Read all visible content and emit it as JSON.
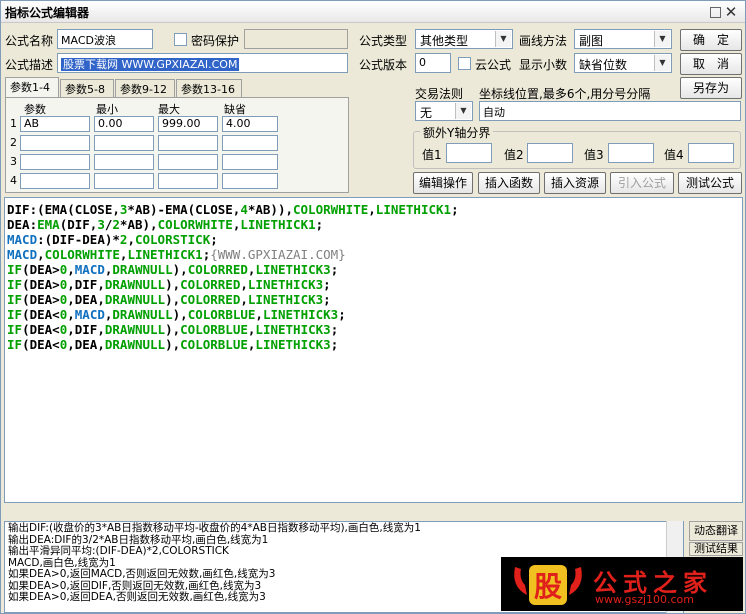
{
  "window": {
    "title": "指标公式编辑器"
  },
  "form": {
    "name_label": "公式名称",
    "name_value": "MACD波浪",
    "password_label": "密码保护",
    "desc_label": "公式描述",
    "desc_value": "股票下载网 WWW.GPXIAZAI.COM",
    "type_label": "公式类型",
    "type_value": "其他类型",
    "draw_label": "画线方法",
    "draw_value": "副图",
    "version_label": "公式版本",
    "version_value": "0",
    "cloud_label": "云公式",
    "decimal_label": "显示小数",
    "decimal_value": "缺省位数",
    "trade_label": "交易法则",
    "trade_value": "无",
    "coord_label": "坐标线位置,最多6个,用分号分隔",
    "coord_value": "自动",
    "extra_axis_label": "额外Y轴分界",
    "axis_values": [
      "值1",
      "值2",
      "值3",
      "值4"
    ]
  },
  "buttons": {
    "ok": "确　定",
    "cancel": "取　消",
    "save_as": "另存为",
    "edit_ops": "编辑操作",
    "insert_func": "插入函数",
    "insert_res": "插入资源",
    "import_formula": "引入公式",
    "test_formula": "测试公式",
    "dyn_translate": "动态翻译",
    "test_result": "测试结果"
  },
  "tabs": [
    "参数1-4",
    "参数5-8",
    "参数9-12",
    "参数13-16"
  ],
  "params": {
    "headers": [
      "参数",
      "最小",
      "最大",
      "缺省"
    ],
    "rows": [
      {
        "num": "1",
        "name": "AB",
        "min": "0.00",
        "max": "999.00",
        "def": "4.00"
      },
      {
        "num": "2",
        "name": "",
        "min": "",
        "max": "",
        "def": ""
      },
      {
        "num": "3",
        "name": "",
        "min": "",
        "max": "",
        "def": ""
      },
      {
        "num": "4",
        "name": "",
        "min": "",
        "max": "",
        "def": ""
      }
    ]
  },
  "code": [
    [
      [
        "c-black",
        "DIF:(EMA(CLOSE,"
      ],
      [
        "c-green",
        "3"
      ],
      [
        "c-black",
        "*AB)-EMA(CLOSE,"
      ],
      [
        "c-green",
        "4"
      ],
      [
        "c-black",
        "*AB)),"
      ],
      [
        "c-green",
        "COLORWHITE"
      ],
      [
        "c-black",
        ","
      ],
      [
        "c-green",
        "LINETHICK1"
      ],
      [
        "c-black",
        ";"
      ]
    ],
    [
      [
        "c-black",
        "DEA:"
      ],
      [
        "c-green",
        "EMA"
      ],
      [
        "c-black",
        "(DIF,"
      ],
      [
        "c-green",
        "3"
      ],
      [
        "c-black",
        "/"
      ],
      [
        "c-green",
        "2"
      ],
      [
        "c-black",
        "*AB),"
      ],
      [
        "c-green",
        "COLORWHITE"
      ],
      [
        "c-black",
        ","
      ],
      [
        "c-green",
        "LINETHICK1"
      ],
      [
        "c-black",
        ";"
      ]
    ],
    [
      [
        "c-blue",
        "MACD"
      ],
      [
        "c-black",
        ":(DIF-DEA)*"
      ],
      [
        "c-green",
        "2"
      ],
      [
        "c-black",
        ","
      ],
      [
        "c-green",
        "COLORSTICK"
      ],
      [
        "c-black",
        ";"
      ]
    ],
    [
      [
        "c-blue",
        "MACD"
      ],
      [
        "c-black",
        ","
      ],
      [
        "c-green",
        "COLORWHITE"
      ],
      [
        "c-black",
        ","
      ],
      [
        "c-green",
        "LINETHICK1"
      ],
      [
        "c-black",
        ";"
      ],
      [
        "c-gray",
        "{WWW.GPXIAZAI.COM}"
      ]
    ],
    [
      [
        "c-green",
        "IF"
      ],
      [
        "c-black",
        "(DEA>"
      ],
      [
        "c-green",
        "0"
      ],
      [
        "c-black",
        ","
      ],
      [
        "c-blue",
        "MACD"
      ],
      [
        "c-black",
        ","
      ],
      [
        "c-green",
        "DRAWNULL"
      ],
      [
        "c-black",
        "),"
      ],
      [
        "c-green",
        "COLORRED"
      ],
      [
        "c-black",
        ","
      ],
      [
        "c-green",
        "LINETHICK3"
      ],
      [
        "c-black",
        ";"
      ]
    ],
    [
      [
        "c-green",
        "IF"
      ],
      [
        "c-black",
        "(DEA>"
      ],
      [
        "c-green",
        "0"
      ],
      [
        "c-black",
        ",DIF,"
      ],
      [
        "c-green",
        "DRAWNULL"
      ],
      [
        "c-black",
        "),"
      ],
      [
        "c-green",
        "COLORRED"
      ],
      [
        "c-black",
        ","
      ],
      [
        "c-green",
        "LINETHICK3"
      ],
      [
        "c-black",
        ";"
      ]
    ],
    [
      [
        "c-green",
        "IF"
      ],
      [
        "c-black",
        "(DEA>"
      ],
      [
        "c-green",
        "0"
      ],
      [
        "c-black",
        ",DEA,"
      ],
      [
        "c-green",
        "DRAWNULL"
      ],
      [
        "c-black",
        "),"
      ],
      [
        "c-green",
        "COLORRED"
      ],
      [
        "c-black",
        ","
      ],
      [
        "c-green",
        "LINETHICK3"
      ],
      [
        "c-black",
        ";"
      ]
    ],
    [
      [
        "c-green",
        "IF"
      ],
      [
        "c-black",
        "(DEA<"
      ],
      [
        "c-green",
        "0"
      ],
      [
        "c-black",
        ","
      ],
      [
        "c-blue",
        "MACD"
      ],
      [
        "c-black",
        ","
      ],
      [
        "c-green",
        "DRAWNULL"
      ],
      [
        "c-black",
        "),"
      ],
      [
        "c-green",
        "COLORBLUE"
      ],
      [
        "c-black",
        ","
      ],
      [
        "c-green",
        "LINETHICK3"
      ],
      [
        "c-black",
        ";"
      ]
    ],
    [
      [
        "c-green",
        "IF"
      ],
      [
        "c-black",
        "(DEA<"
      ],
      [
        "c-green",
        "0"
      ],
      [
        "c-black",
        ",DIF,"
      ],
      [
        "c-green",
        "DRAWNULL"
      ],
      [
        "c-black",
        "),"
      ],
      [
        "c-green",
        "COLORBLUE"
      ],
      [
        "c-black",
        ","
      ],
      [
        "c-green",
        "LINETHICK3"
      ],
      [
        "c-black",
        ";"
      ]
    ],
    [
      [
        "c-green",
        "IF"
      ],
      [
        "c-black",
        "(DEA<"
      ],
      [
        "c-green",
        "0"
      ],
      [
        "c-black",
        ",DEA,"
      ],
      [
        "c-green",
        "DRAWNULL"
      ],
      [
        "c-black",
        "),"
      ],
      [
        "c-green",
        "COLORBLUE"
      ],
      [
        "c-black",
        ","
      ],
      [
        "c-green",
        "LINETHICK3"
      ],
      [
        "c-black",
        ";"
      ]
    ]
  ],
  "output_lines": [
    "输出DIF:(收盘价的3*AB日指数移动平均-收盘价的4*AB日指数移动平均),画白色,线宽为1",
    "输出DEA:DIF的3/2*AB日指数移动平均,画白色,线宽为1",
    "输出平滑异同平均:(DIF-DEA)*2,COLORSTICK",
    "MACD,画白色,线宽为1",
    "如果DEA>0,返回MACD,否则返回无效数,画红色,线宽为3",
    "如果DEA>0,返回DIF,否则返回无效数,画红色,线宽为3",
    "如果DEA>0,返回DEA,否则返回无效数,画红色,线宽为3"
  ],
  "logo": {
    "mark": "股",
    "text": "公式之家",
    "url": "www.gszj100.com"
  }
}
